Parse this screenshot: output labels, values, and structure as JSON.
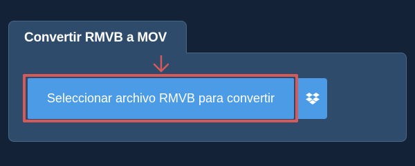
{
  "converter": {
    "title": "Convertir RMVB a MOV",
    "select_button_label": "Seleccionar archivo RMVB para convertir",
    "dropbox_icon": "dropbox-icon",
    "arrow_icon": "arrow-down-icon"
  },
  "colors": {
    "background": "#132236",
    "panel": "#2f4b6b",
    "button": "#4c9be6",
    "highlight": "#d65a5a"
  }
}
